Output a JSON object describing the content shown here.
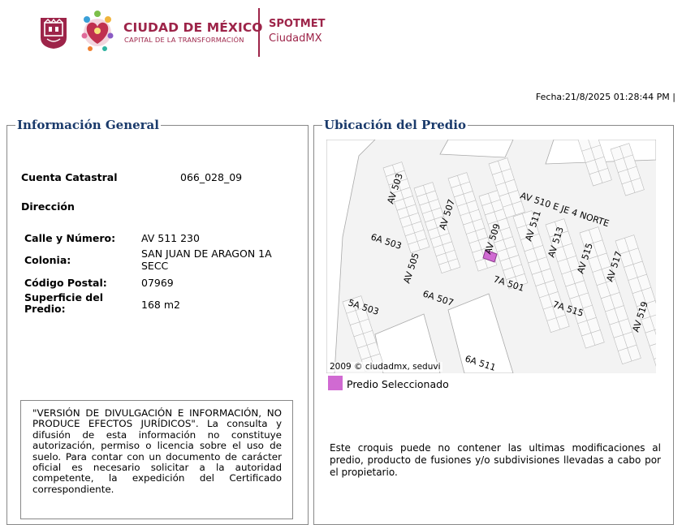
{
  "header": {
    "org_name": "CIUDAD DE MÉXICO",
    "org_subtitle": "CAPITAL DE LA TRANSFORMACIÓN",
    "app_name": "SPOTMET",
    "app_subtitle": "CiudadMX",
    "brand_color": "#9d2449"
  },
  "fecha": "Fecha:21/8/2025 01:28:44 PM |",
  "general": {
    "legend": "Información General",
    "cuenta_label": "Cuenta Catastral",
    "cuenta_value": "066_028_09",
    "direccion_label": "Dirección",
    "calle_label": "Calle y Número:",
    "calle_value": "AV 511 230",
    "colonia_label": "Colonia:",
    "colonia_value": "SAN JUAN DE ARAGON 1A SECC",
    "cp_label": "Código Postal:",
    "cp_value": "07969",
    "superficie_label": "Superficie del Predio:",
    "superficie_value": "168 m2",
    "disclaimer": "\"VERSIÓN DE DIVULGACIÓN E INFORMACIÓN, NO PRODUCE EFECTOS JURÍDICOS\". La consulta y difusión de esta información no constituye autorización, permiso o licencia sobre el uso de suelo. Para contar con un documento de carácter oficial es necesario solicitar a la autoridad competente, la expedición del Certificado correspondiente."
  },
  "ubicacion": {
    "legend": "Ubicación del Predio",
    "map_copyright": "2009 © ciudadmx, seduvi",
    "legend_item": "Predio Seleccionado",
    "selected_color": "#d06ad2",
    "street_labels": [
      "AV 503",
      "AV 510 E JE 4 NORTE",
      "AV 509",
      "AV 507",
      "AV 511",
      "AV 513",
      "AV 515",
      "AV 517",
      "AV 505",
      "6A 503",
      "7A 501",
      "6A 507",
      "5A 503",
      "7A 515",
      "AV 519",
      "6A 511"
    ],
    "note": "Este croquis puede no contener las ultimas modificaciones al predio, producto de fusiones y/o subdivisiones llevadas a cabo por el propietario."
  }
}
